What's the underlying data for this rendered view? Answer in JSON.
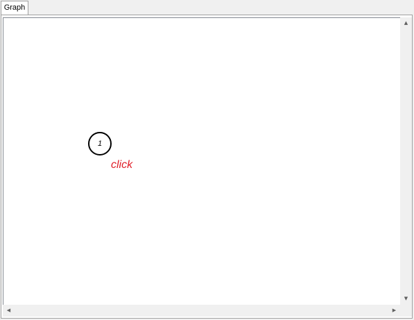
{
  "tabs": [
    {
      "label": "Graph",
      "active": true
    }
  ],
  "graph": {
    "nodes": [
      {
        "label": "1"
      }
    ],
    "annotation": {
      "text": "click",
      "color": "#e0202a"
    }
  },
  "scrollbars": {
    "vertical": {
      "up_icon": "arrow-up-icon",
      "down_icon": "arrow-down-icon"
    },
    "horizontal": {
      "left_icon": "arrow-left-icon",
      "right_icon": "arrow-right-icon"
    }
  }
}
